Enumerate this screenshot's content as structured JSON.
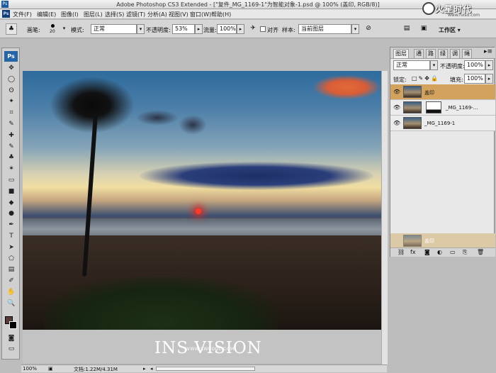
{
  "window": {
    "title": "Adobe Photoshop CS3 Extended - [\"复件_MG_1169-1\"为智能对象-1.psd @ 100% (盖印, RGB/8)]"
  },
  "menu": {
    "items": [
      "文件(F)",
      "编辑(E)",
      "图像(I)",
      "图层(L)",
      "选择(S)",
      "滤镜(T)",
      "分析(A)",
      "视图(V)",
      "窗口(W)",
      "帮助(H)"
    ]
  },
  "brand": {
    "text": "火星时代",
    "url": "www.hxsd.com"
  },
  "options": {
    "brush_label": "画笔:",
    "brush_size": "20",
    "mode_label": "模式:",
    "mode_value": "正常",
    "opacity_label": "不透明度:",
    "opacity_value": "53%",
    "flow_label": "流量:",
    "flow_value": "100%",
    "aligned_label": "对齐",
    "sample_label": "样本:",
    "sample_value": "当前图层",
    "workspace_label": "工作区 ▾"
  },
  "tools": {
    "badge": "Ps",
    "icons": [
      "move-icon",
      "marquee-icon",
      "lasso-icon",
      "magic-wand-icon",
      "crop-icon",
      "slice-icon",
      "healing-icon",
      "brush-icon",
      "clone-stamp-icon",
      "history-brush-icon",
      "eraser-icon",
      "gradient-icon",
      "blur-icon",
      "dodge-icon",
      "pen-icon",
      "type-icon",
      "path-select-icon",
      "shape-icon",
      "notes-icon",
      "eyedropper-icon",
      "hand-icon",
      "zoom-icon"
    ],
    "glyphs": [
      "✥",
      "◯",
      "ʘ",
      "✦",
      "⌗",
      "✎",
      "✚",
      "✎",
      "♣",
      "✶",
      "▭",
      "■",
      "◆",
      "●",
      "✒",
      "T",
      "➤",
      "⬠",
      "▤",
      "✐",
      "✋",
      "🔍"
    ],
    "foreground_color": "#5a3a36",
    "background_color": "#000000"
  },
  "canvas": {
    "watermark": "INS VISION",
    "watermark_small": "WWW.SWCOOL.COM"
  },
  "status": {
    "zoom": "100%",
    "doc_info": "文档:1.22M/4.31M"
  },
  "layers_panel": {
    "tabs": [
      "图层",
      "通",
      "路",
      "绿",
      "调",
      "绳"
    ],
    "blend_mode": "正常",
    "opacity_label": "不透明度:",
    "opacity_value": "100%",
    "lock_label": "锁定:",
    "fill_label": "填充:",
    "fill_value": "100%",
    "layers": [
      {
        "name": "盖印",
        "selected": true
      },
      {
        "name": "_MG_1169-...",
        "selected": false
      },
      {
        "name": "_MG_1169-1",
        "selected": false
      }
    ],
    "bottom_layer_name": "盖印",
    "footer_icons": [
      "link-icon",
      "fx-icon",
      "mask-icon",
      "adjustment-icon",
      "group-icon",
      "new-layer-icon",
      "trash-icon"
    ],
    "footer_glyphs": [
      "⛓",
      "fx",
      "◙",
      "◐",
      "▭",
      "⎘",
      "🗑"
    ]
  }
}
